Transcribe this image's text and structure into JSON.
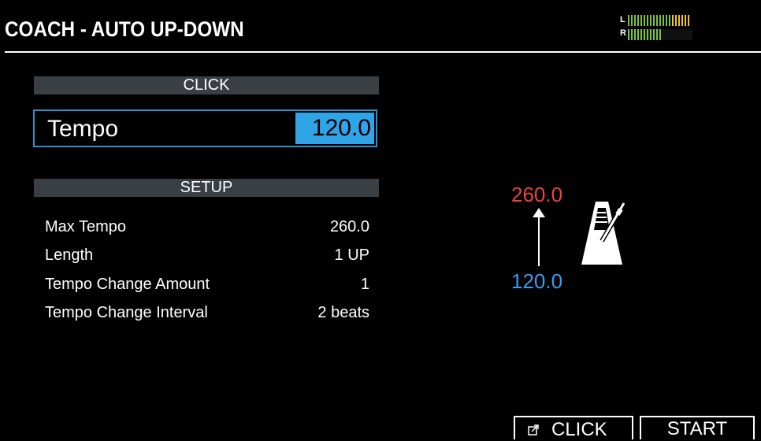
{
  "header": {
    "title": "COACH - AUTO UP-DOWN",
    "meter": {
      "left_label": "L",
      "right_label": "R",
      "left_level": 1.0,
      "right_level": 0.55,
      "colors": {
        "low": "#7bc043",
        "high": "#f5c518"
      }
    }
  },
  "click_section": {
    "heading": "CLICK",
    "tempo_label": "Tempo",
    "tempo_value": "120.0"
  },
  "setup_section": {
    "heading": "SETUP",
    "params": [
      {
        "name": "Max Tempo",
        "value": "260.0"
      },
      {
        "name": "Length",
        "value": "1 UP"
      },
      {
        "name": "Tempo Change Amount",
        "value": "1"
      },
      {
        "name": "Tempo Change Interval",
        "value": "2 beats"
      }
    ]
  },
  "diagram": {
    "max_tempo": "260.0",
    "start_tempo": "120.0",
    "max_color": "#e8453b",
    "start_color": "#3a9cf0",
    "icon": "metronome-icon"
  },
  "soft_buttons": {
    "click": "CLICK",
    "start": "START"
  },
  "colors": {
    "accent": "#2fa4e7",
    "section_bar": "#3a3f44",
    "background": "#000000"
  }
}
